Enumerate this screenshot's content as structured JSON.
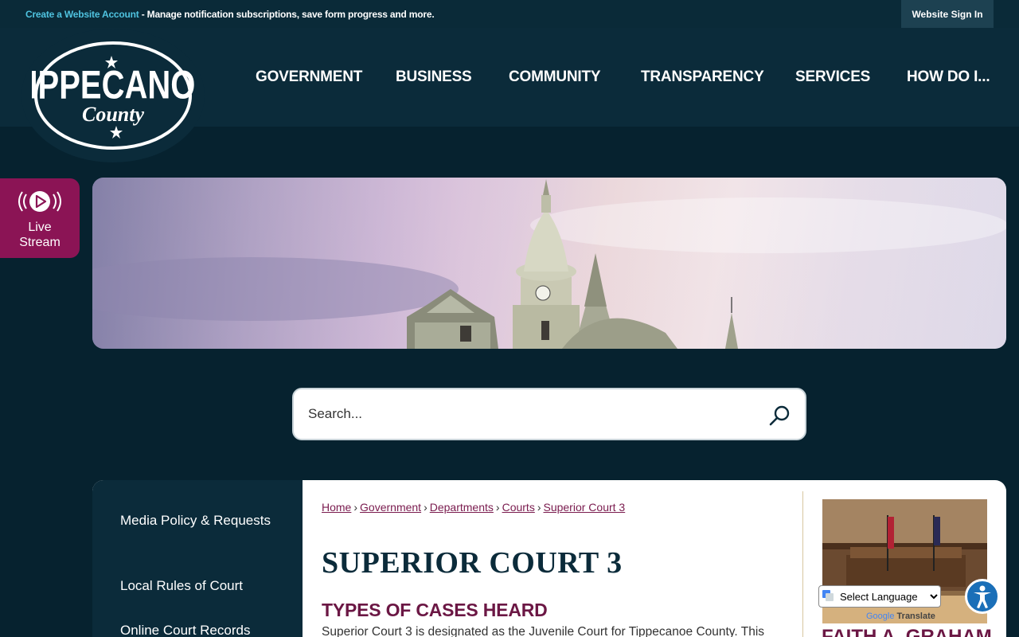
{
  "topbar": {
    "create_account_link": "Create a Website Account",
    "message": " - Manage notification subscriptions, save form progress and more.",
    "signin_label": "Website Sign In"
  },
  "logo": {
    "line1": "TIPPECANOE",
    "line2": "County"
  },
  "nav": {
    "items": [
      "GOVERNMENT",
      "BUSINESS",
      "COMMUNITY",
      "TRANSPARENCY",
      "SERVICES",
      "HOW DO I..."
    ]
  },
  "live_stream": {
    "line1": "Live",
    "line2": "Stream"
  },
  "search": {
    "placeholder": "Search..."
  },
  "sidenav": {
    "items": [
      "Media Policy & Requests",
      "Local Rules of Court",
      "Online Court Records"
    ]
  },
  "breadcrumb": {
    "items": [
      "Home",
      "Government",
      "Departments",
      "Courts",
      "Superior Court 3"
    ],
    "separator": "›"
  },
  "page": {
    "title": "SUPERIOR COURT 3",
    "subtitle": "TYPES OF CASES HEARD",
    "paragraph": "Superior Court 3 is designated as the Juvenile Court for Tippecanoe County. This"
  },
  "sidebar_right": {
    "judge_name": "FAITH A. GRAHAM"
  },
  "translate": {
    "select_label": "Select Language",
    "powered_google": "Google",
    "powered_translate": "Translate"
  },
  "colors": {
    "background": "#06222f",
    "header": "#0b2b3a",
    "accent_magenta": "#8b1455",
    "link_cyan": "#4fc3e0",
    "breadcrumb_link": "#7a1b4e",
    "subtitle": "#6b1744"
  }
}
